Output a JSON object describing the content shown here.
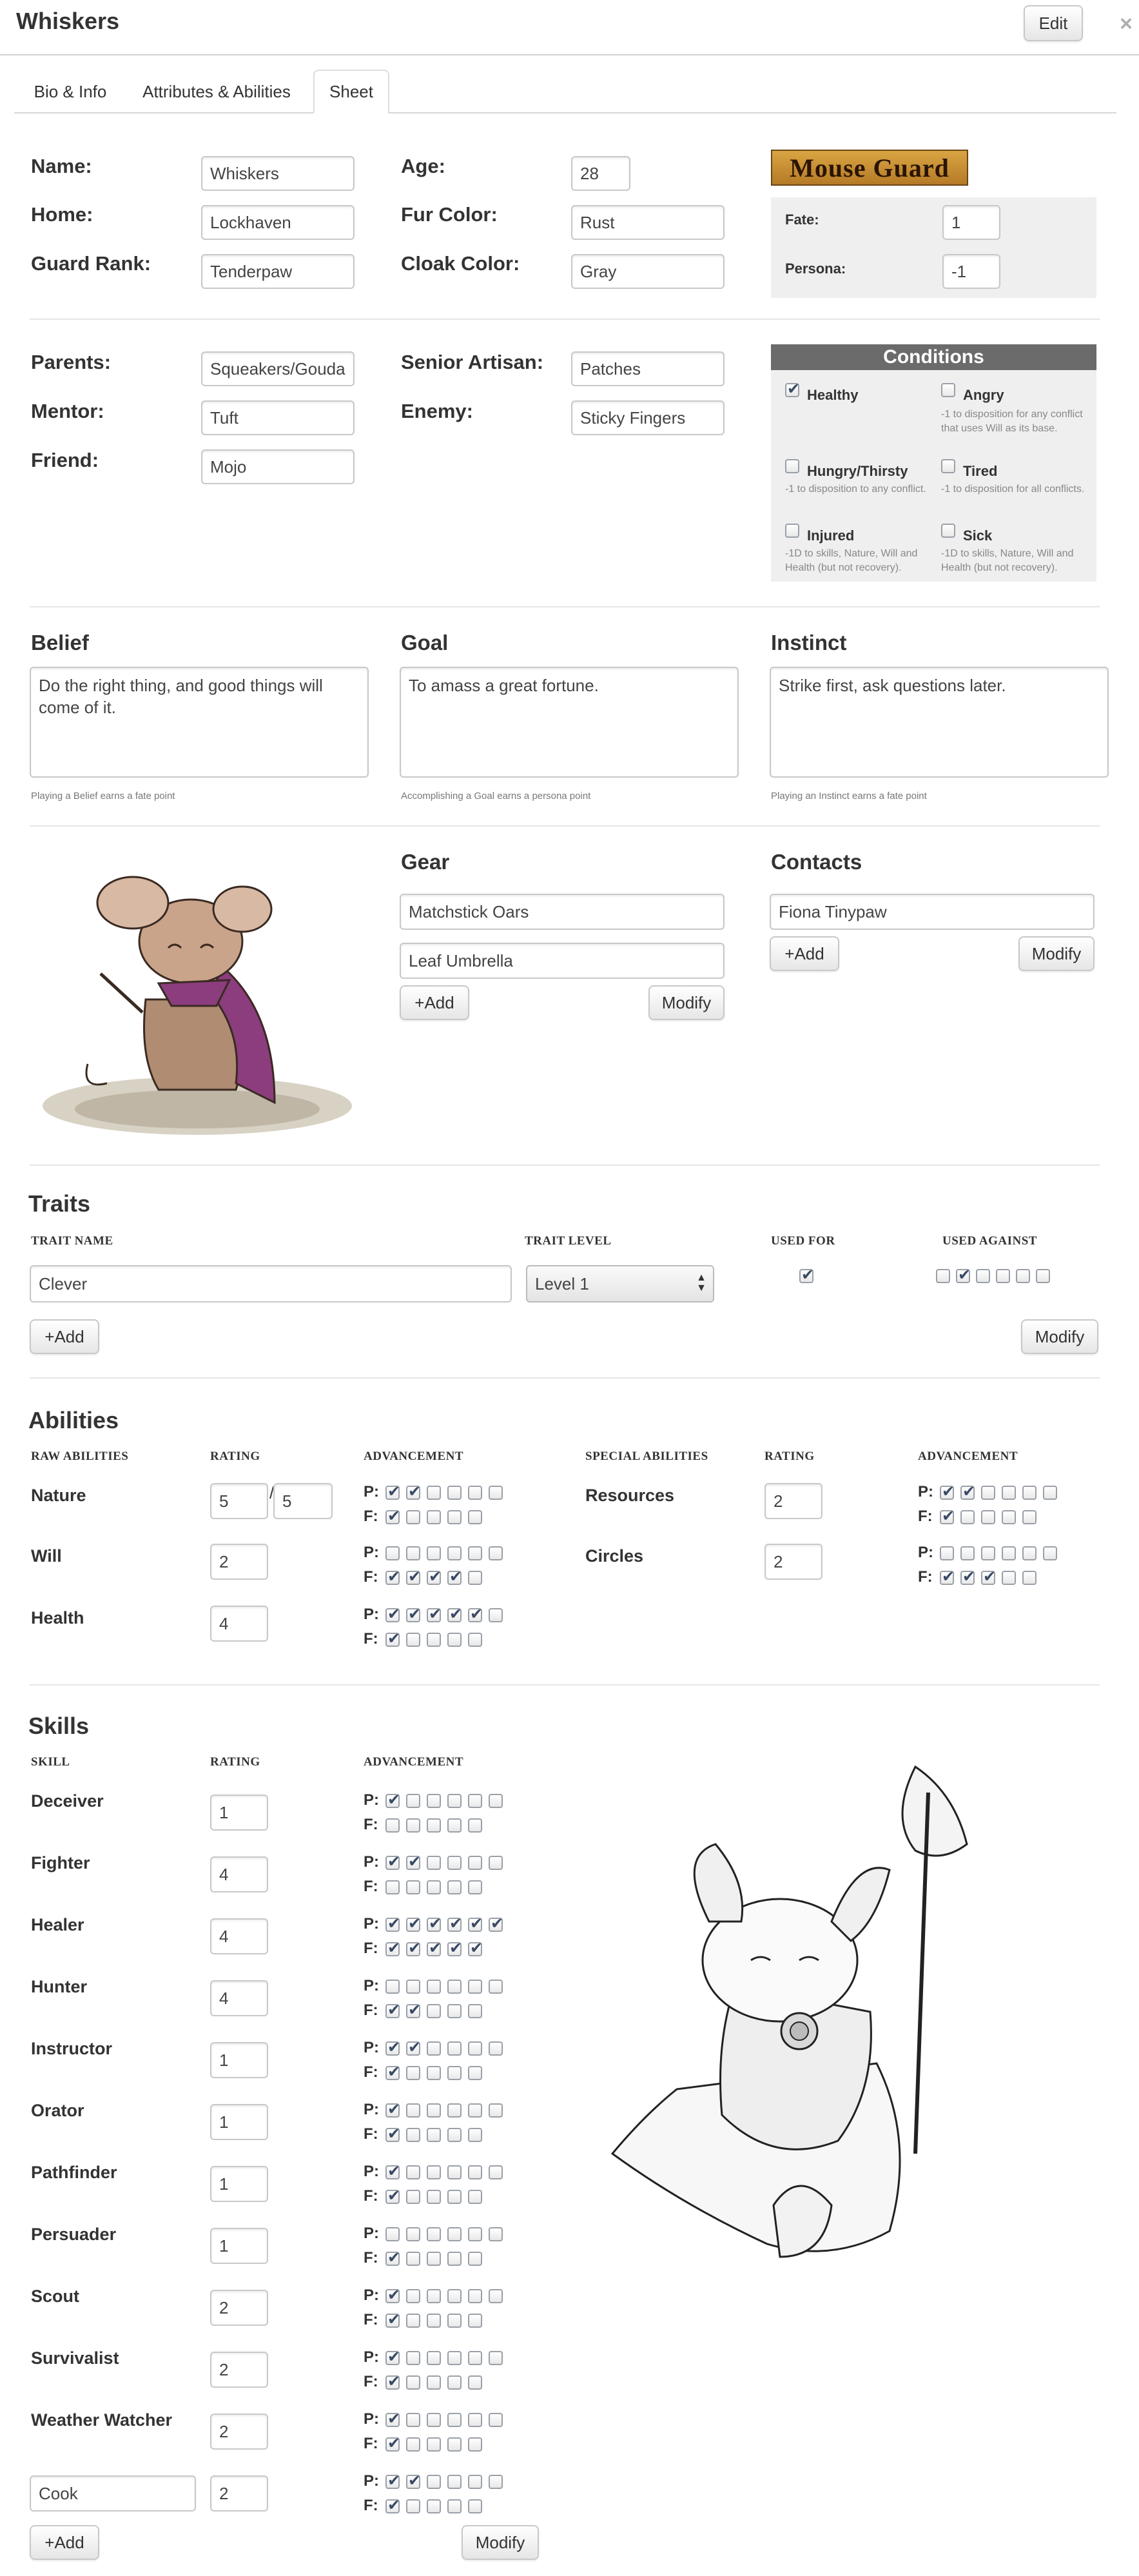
{
  "header": {
    "title": "Whiskers",
    "edit_label": "Edit",
    "close_glyph": "×"
  },
  "tabs": [
    "Bio & Info",
    "Attributes & Abilities",
    "Sheet"
  ],
  "bio": {
    "name_label": "Name:",
    "name": "Whiskers",
    "home_label": "Home:",
    "home": "Lockhaven",
    "rank_label": "Guard Rank:",
    "rank": "Tenderpaw",
    "age_label": "Age:",
    "age": "28",
    "fur_label": "Fur Color:",
    "fur": "Rust",
    "cloak_label": "Cloak Color:",
    "cloak": "Gray",
    "logo_text": "Mouse Guard",
    "fate_label": "Fate:",
    "fate": "1",
    "persona_label": "Persona:",
    "persona": "-1"
  },
  "relations": {
    "parents_label": "Parents:",
    "parents": "Squeakers/Gouda",
    "mentor_label": "Mentor:",
    "mentor": "Tuft",
    "friend_label": "Friend:",
    "friend": "Mojo",
    "artisan_label": "Senior Artisan:",
    "artisan": "Patches",
    "enemy_label": "Enemy:",
    "enemy": "Sticky Fingers"
  },
  "conditions": {
    "title": "Conditions",
    "items": [
      {
        "name": "Healthy",
        "checked": true,
        "desc": ""
      },
      {
        "name": "Angry",
        "checked": false,
        "desc": "-1 to disposition for any conflict that uses Will as its base."
      },
      {
        "name": "Hungry/Thirsty",
        "checked": false,
        "desc": "-1 to disposition to any conflict."
      },
      {
        "name": "Tired",
        "checked": false,
        "desc": "-1 to disposition for all conflicts."
      },
      {
        "name": "Injured",
        "checked": false,
        "desc": "-1D to skills, Nature, Will and Health (but not recovery)."
      },
      {
        "name": "Sick",
        "checked": false,
        "desc": "-1D to skills, Nature, Will and Health (but not recovery)."
      }
    ]
  },
  "bgi": {
    "belief_label": "Belief",
    "belief": "Do the right thing, and good things will come of it.",
    "belief_note": "Playing a Belief earns a fate point",
    "goal_label": "Goal",
    "goal": "To amass a great fortune.",
    "goal_note": "Accomplishing a Goal earns a persona point",
    "instinct_label": "Instinct",
    "instinct": "Strike first, ask questions later.",
    "instinct_note": "Playing an Instinct earns a fate point"
  },
  "gear": {
    "title": "Gear",
    "items": [
      "Matchstick Oars",
      "Leaf Umbrella"
    ]
  },
  "contacts": {
    "title": "Contacts",
    "items": [
      "Fiona Tinypaw"
    ]
  },
  "buttons": {
    "add": "+Add",
    "modify": "Modify"
  },
  "traits": {
    "title": "Traits",
    "headers": [
      "TRAIT NAME",
      "TRAIT LEVEL",
      "USED FOR",
      "USED AGAINST"
    ],
    "rows": [
      {
        "name": "Clever",
        "level": "Level 1",
        "used_for": true,
        "used_against": [
          false,
          true,
          false,
          false,
          false,
          false
        ]
      }
    ]
  },
  "abilities": {
    "title": "Abilities",
    "raw_headers": [
      "RAW ABILITIES",
      "RATING",
      "ADVANCEMENT"
    ],
    "special_headers": [
      "SPECIAL ABILITIES",
      "RATING",
      "ADVANCEMENT"
    ],
    "raw": [
      {
        "name": "Nature",
        "rating": "5",
        "max": "5",
        "p": 2,
        "p_total": 6,
        "f": 1,
        "f_total": 5
      },
      {
        "name": "Will",
        "rating": "2",
        "p": 0,
        "p_total": 6,
        "f": 4,
        "f_total": 5
      },
      {
        "name": "Health",
        "rating": "4",
        "p": 5,
        "p_total": 6,
        "f": 1,
        "f_total": 5
      }
    ],
    "special": [
      {
        "name": "Resources",
        "rating": "2",
        "p": 2,
        "p_total": 6,
        "f": 1,
        "f_total": 5
      },
      {
        "name": "Circles",
        "rating": "2",
        "p": 0,
        "p_total": 6,
        "f": 3,
        "f_total": 5
      }
    ],
    "slash": "/"
  },
  "skills": {
    "title": "Skills",
    "headers": [
      "SKILL",
      "RATING",
      "ADVANCEMENT"
    ],
    "p_label": "P:",
    "f_label": "F:",
    "rows": [
      {
        "name": "Deceiver",
        "rating": "1",
        "p": 1,
        "f": 0
      },
      {
        "name": "Fighter",
        "rating": "4",
        "p": 2,
        "f": 0
      },
      {
        "name": "Healer",
        "rating": "4",
        "p": 6,
        "f": 5
      },
      {
        "name": "Hunter",
        "rating": "4",
        "p": 0,
        "f": 2
      },
      {
        "name": "Instructor",
        "rating": "1",
        "p": 2,
        "f": 1
      },
      {
        "name": "Orator",
        "rating": "1",
        "p": 1,
        "f": 1
      },
      {
        "name": "Pathfinder",
        "rating": "1",
        "p": 1,
        "f": 1
      },
      {
        "name": "Persuader",
        "rating": "1",
        "p": 0,
        "f": 1
      },
      {
        "name": "Scout",
        "rating": "2",
        "p": 1,
        "f": 1
      },
      {
        "name": "Survivalist",
        "rating": "2",
        "p": 1,
        "f": 1
      },
      {
        "name": "Weather Watcher",
        "rating": "2",
        "p": 1,
        "f": 1
      },
      {
        "name": "Cook",
        "rating": "2",
        "p": 2,
        "f": 1,
        "editable": true
      }
    ]
  },
  "colors": {
    "accent": "#3a4a66",
    "conditions_header": "#6b6b6b",
    "logo": "#c8903a"
  }
}
